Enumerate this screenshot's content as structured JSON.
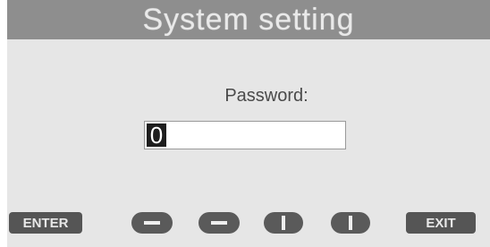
{
  "header": {
    "title": "System setting"
  },
  "password": {
    "label": "Password:",
    "value": "0"
  },
  "softkeys": {
    "enter": "ENTER",
    "left": "left-arrow-icon",
    "right": "right-arrow-icon",
    "up": "up-arrow-icon",
    "down": "down-arrow-icon",
    "exit": "EXIT"
  },
  "colors": {
    "title_bar": "#8e8e8e",
    "background": "#e6e6e6",
    "key": "#555555"
  }
}
